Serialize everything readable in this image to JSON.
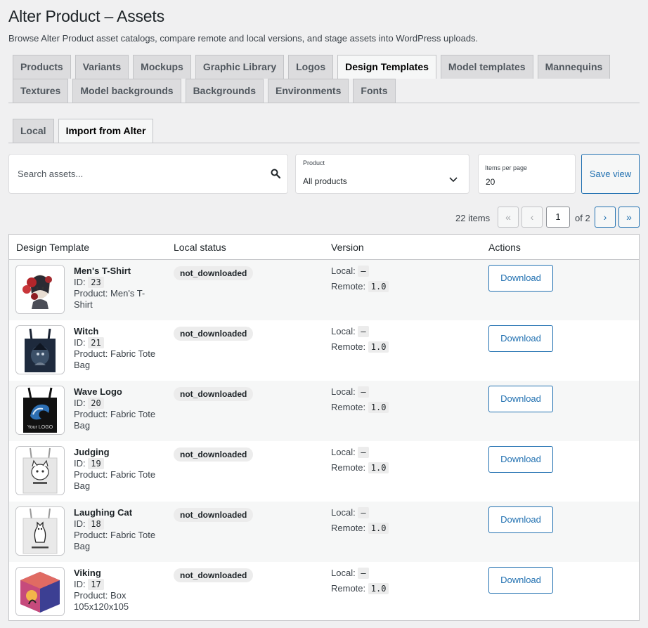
{
  "header": {
    "title": "Alter Product – Assets",
    "description": "Browse Alter Product asset catalogs, compare remote and local versions, and stage assets into WordPress uploads."
  },
  "tabs": {
    "active": "Design Templates",
    "row1": [
      "Products",
      "Variants",
      "Mockups",
      "Graphic Library",
      "Logos",
      "Design Templates",
      "Model templates",
      "Mannequins"
    ],
    "row2": [
      "Textures",
      "Model backgrounds",
      "Backgrounds",
      "Environments",
      "Fonts"
    ]
  },
  "subtabs": {
    "local": "Local",
    "import": "Import from Alter",
    "active": "Import from Alter"
  },
  "filters": {
    "search_placeholder": "Search assets...",
    "search_value": "",
    "product_label": "Product",
    "product_value": "All products",
    "items_per_page_label": "Items per page",
    "items_per_page_value": "20",
    "save_view": "Save view"
  },
  "pagination": {
    "items": "22 items",
    "first": "«",
    "prev": "‹",
    "current_page": "1",
    "of": "of 2",
    "next": "›",
    "last": "»"
  },
  "table": {
    "headers": [
      "Design Template",
      "Local status",
      "Version",
      "Actions"
    ],
    "id_label": "ID:",
    "product_label": "Product:",
    "local_label": "Local:",
    "remote_label": "Remote:",
    "download_label": "Download",
    "rows": [
      {
        "name": "Men's T-Shirt",
        "id": "23",
        "product": "Men's T-Shirt",
        "status": "not_downloaded",
        "local": "–",
        "remote": "1.0",
        "thumb": "tshirt-art"
      },
      {
        "name": "Witch",
        "id": "21",
        "product": "Fabric Tote Bag",
        "status": "not_downloaded",
        "local": "–",
        "remote": "1.0",
        "thumb": "dark-tote"
      },
      {
        "name": "Wave Logo",
        "id": "20",
        "product": "Fabric Tote Bag",
        "status": "not_downloaded",
        "local": "–",
        "remote": "1.0",
        "thumb": "black-tote"
      },
      {
        "name": "Judging",
        "id": "19",
        "product": "Fabric Tote Bag",
        "status": "not_downloaded",
        "local": "–",
        "remote": "1.0",
        "thumb": "white-tote"
      },
      {
        "name": "Laughing Cat",
        "id": "18",
        "product": "Fabric Tote Bag",
        "status": "not_downloaded",
        "local": "–",
        "remote": "1.0",
        "thumb": "white-tote-cat"
      },
      {
        "name": "Viking",
        "id": "17",
        "product": "Box 105x120x105",
        "status": "not_downloaded",
        "local": "–",
        "remote": "1.0",
        "thumb": "box"
      }
    ]
  },
  "thumb_text": {
    "your_logo": "Your LOGO"
  }
}
